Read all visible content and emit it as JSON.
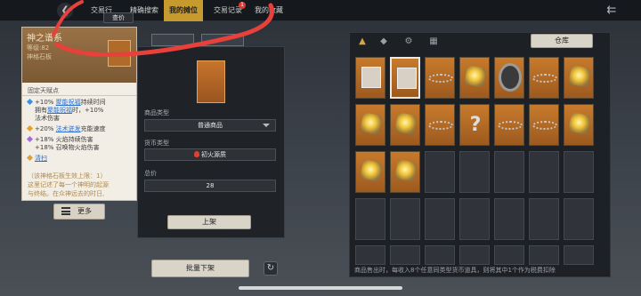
{
  "topbar": {
    "tabs": [
      {
        "label": "交易行",
        "active": false
      },
      {
        "label": "精确搜索",
        "active": false
      },
      {
        "label": "我的摊位",
        "active": true
      },
      {
        "label": "交易记录",
        "active": false,
        "badge": "1"
      },
      {
        "label": "我的收藏",
        "active": false
      }
    ],
    "query_label": "查价",
    "back_icon": "back-icon",
    "exit_icon": "exit-icon"
  },
  "detail": {
    "name": "神之谱系",
    "level": "等级:82",
    "type": "神格石板",
    "fixed_affix_label": "固定天赋点",
    "affixes": [
      {
        "color": "#3f8fe0",
        "pre": "+10% ",
        "link": "聚能祝福",
        "post": "持续时间"
      },
      {
        "color": "#3f8fe0",
        "pre": "拥有",
        "link": "聚能祝福",
        "post": "时，+10%"
      },
      {
        "color": "none",
        "pre": "法术伤害",
        "link": "",
        "post": ""
      },
      {
        "color": "#e0a030",
        "pre": "+20% ",
        "link": "法术迸发",
        "post": "充能速度"
      },
      {
        "color": "#a070d0",
        "pre": "+18% 火焰持续伤害",
        "link": "",
        "post": ""
      },
      {
        "color": "none",
        "pre": "+18% 召唤物火焰伤害",
        "link": "",
        "post": ""
      },
      {
        "color": "#e0a030",
        "pre": "",
        "link": "清扫",
        "post": ""
      }
    ],
    "note_lines": [
      "（该神格石板生效上限：1）",
      "这里记述了每一个神明的起源",
      "与终结。在众神远去的时日,"
    ],
    "more_label": "更多"
  },
  "listing": {
    "goods_type_label": "商品类型",
    "goods_type_value": "普通商品",
    "currency_label": "货币类型",
    "currency_value": "初火源质",
    "price_label": "总价",
    "price_value": "28",
    "list_button": "上架",
    "bulk_delist_button": "批量下架"
  },
  "repository": {
    "warehouse_button": "仓库",
    "filter_icons": [
      "helmet-icon",
      "bird-icon",
      "gear-circle-icon",
      "grid-icon"
    ],
    "slots": [
      "card",
      "card-sel",
      "chain",
      "gem",
      "disk",
      "chain",
      "gem",
      "gem",
      "gem",
      "chain",
      "question",
      "chain",
      "chain",
      "gem",
      "gem",
      "gem",
      "empty",
      "empty",
      "empty",
      "empty",
      "empty",
      "empty",
      "empty",
      "empty",
      "empty",
      "empty",
      "empty",
      "empty",
      "empty",
      "empty",
      "empty",
      "empty",
      "empty",
      "empty",
      "empty"
    ],
    "footer_note": "商品售出时，每收入8个任意同类型货币道具，则将其中1个作为税费扣除"
  },
  "colors": {
    "accent": "#c79a2e",
    "panel": "#1d2024",
    "scribble": "#e8403a"
  }
}
